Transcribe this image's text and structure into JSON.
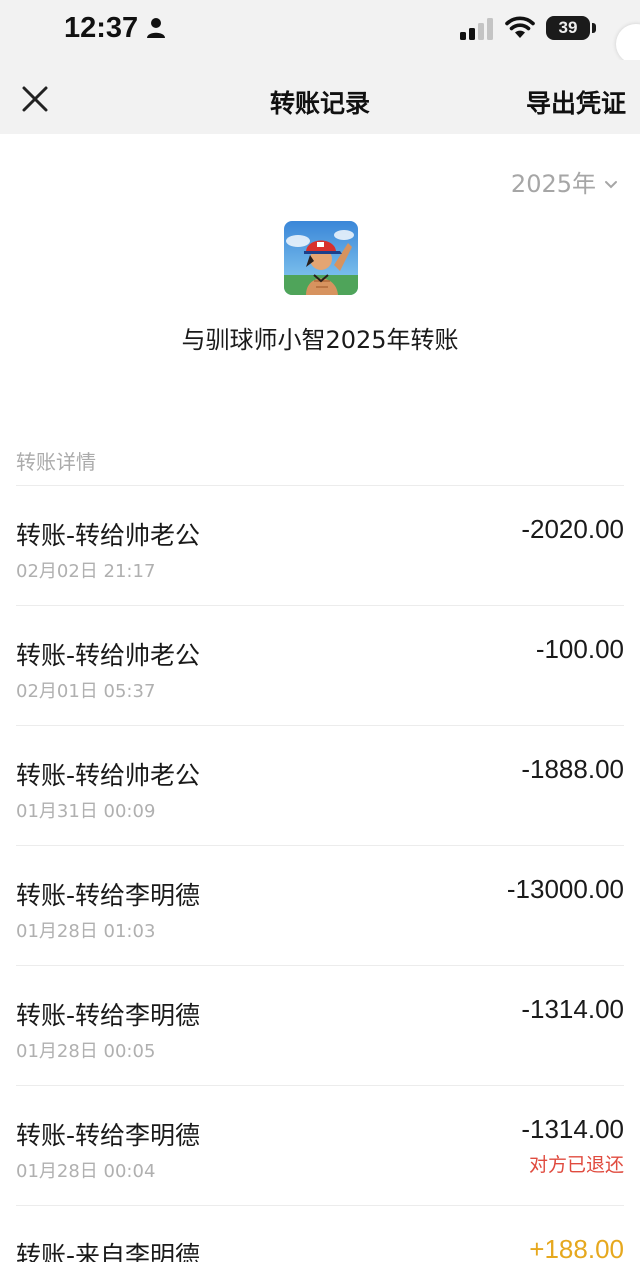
{
  "status_bar": {
    "time": "12:37",
    "battery": "39"
  },
  "nav": {
    "title": "转账记录",
    "export_label": "导出凭证"
  },
  "year_selector": {
    "label": "2025年"
  },
  "header": {
    "title": "与驯球师小智2025年转账"
  },
  "section": {
    "label": "转账详情"
  },
  "transactions": [
    {
      "title": "转账-转给帅老公",
      "time": "02月02日 21:17",
      "amount": "-2020.00",
      "status": ""
    },
    {
      "title": "转账-转给帅老公",
      "time": "02月01日 05:37",
      "amount": "-100.00",
      "status": ""
    },
    {
      "title": "转账-转给帅老公",
      "time": "01月31日 00:09",
      "amount": "-1888.00",
      "status": ""
    },
    {
      "title": "转账-转给李明德",
      "time": "01月28日 01:03",
      "amount": "-13000.00",
      "status": ""
    },
    {
      "title": "转账-转给李明德",
      "time": "01月28日 00:05",
      "amount": "-1314.00",
      "status": ""
    },
    {
      "title": "转账-转给李明德",
      "time": "01月28日 00:04",
      "amount": "-1314.00",
      "status": "对方已退还"
    },
    {
      "title": "转账-来自李明德",
      "time": "",
      "amount": "+188.00",
      "status": ""
    }
  ],
  "colors": {
    "income": "#e6a81e",
    "refunded": "#e04b3f",
    "muted": "#b0b0b0"
  }
}
